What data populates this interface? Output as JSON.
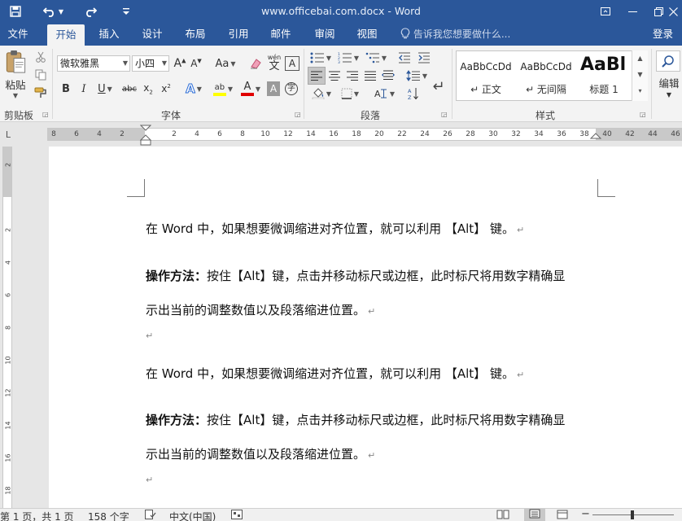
{
  "title_bar": {
    "title": "www.officebai.com.docx - Word",
    "quick_access": [
      {
        "name": "save-icon",
        "glyph": "🖫"
      },
      {
        "name": "undo-icon",
        "glyph": "↶"
      },
      {
        "name": "redo-icon",
        "glyph": "↷"
      },
      {
        "name": "customize-qa-icon",
        "glyph": "≡"
      }
    ],
    "window_buttons": [
      {
        "name": "ribbon-display-options-icon",
        "glyph": "▣"
      },
      {
        "name": "minimize-icon",
        "glyph": "—"
      },
      {
        "name": "restore-icon",
        "glyph": "❐"
      },
      {
        "name": "close-icon",
        "glyph": "✕"
      }
    ]
  },
  "tabs": [
    {
      "label": "文件",
      "active": false
    },
    {
      "label": "开始",
      "active": true
    },
    {
      "label": "插入",
      "active": false
    },
    {
      "label": "设计",
      "active": false
    },
    {
      "label": "布局",
      "active": false
    },
    {
      "label": "引用",
      "active": false
    },
    {
      "label": "邮件",
      "active": false
    },
    {
      "label": "审阅",
      "active": false
    },
    {
      "label": "视图",
      "active": false
    }
  ],
  "tell_me": "告诉我您想要做什么...",
  "login_label": "登录",
  "ribbon": {
    "clipboard": {
      "paste_label": "粘贴",
      "group_label": "剪贴板"
    },
    "font": {
      "font_name": "微软雅黑",
      "font_size": "小四",
      "group_label": "字体",
      "wen_label": "wén"
    },
    "paragraph": {
      "group_label": "段落"
    },
    "styles": {
      "group_label": "样式",
      "items": [
        {
          "sample": "AaBbCcDd",
          "name": "↵ 正文"
        },
        {
          "sample": "AaBbCcDd",
          "name": "↵ 无间隔"
        },
        {
          "sample": "AaBl",
          "name": "标题 1"
        }
      ]
    },
    "editing": {
      "label": "编辑"
    }
  },
  "ruler": {
    "corner_glyph": "L",
    "ticks": [
      "8",
      "6",
      "4",
      "2",
      "2",
      "4",
      "6",
      "8",
      "10",
      "12",
      "14",
      "16",
      "18",
      "20",
      "22",
      "24",
      "26",
      "28",
      "30",
      "32",
      "34",
      "36",
      "38",
      "40",
      "42",
      "44",
      "46"
    ]
  },
  "vruler": {
    "ticks": [
      "2",
      "",
      "2",
      "4",
      "6",
      "8",
      "10",
      "12",
      "14",
      "16",
      "18"
    ]
  },
  "document": {
    "paragraphs": [
      {
        "bold": "",
        "text": "在 Word 中，如果想要微调缩进对齐位置，就可以利用 【Alt】 键。"
      },
      {
        "bold": "操作方法：",
        "text": "按住【Alt】键，点击并移动标尺或边框，此时标尺将用数字精确显"
      },
      {
        "bold": "",
        "text": "示出当前的调整数值以及段落缩进位置。"
      },
      {
        "bold": "",
        "text": ""
      },
      {
        "bold": "",
        "text": "在 Word 中，如果想要微调缩进对齐位置，就可以利用 【Alt】 键。"
      },
      {
        "bold": "操作方法：",
        "text": "按住【Alt】键，点击并移动标尺或边框，此时标尺将用数字精确显"
      },
      {
        "bold": "",
        "text": "示出当前的调整数值以及段落缩进位置。"
      },
      {
        "bold": "",
        "text": ""
      }
    ],
    "paragraph_mark": "↵"
  },
  "status_bar": {
    "page": "第 1 页，共 1 页",
    "words": "158 个字",
    "language": "中文(中国)"
  },
  "colors": {
    "accent": "#2b579a",
    "highlight": "#ffff00",
    "font_color": "#e00000"
  }
}
